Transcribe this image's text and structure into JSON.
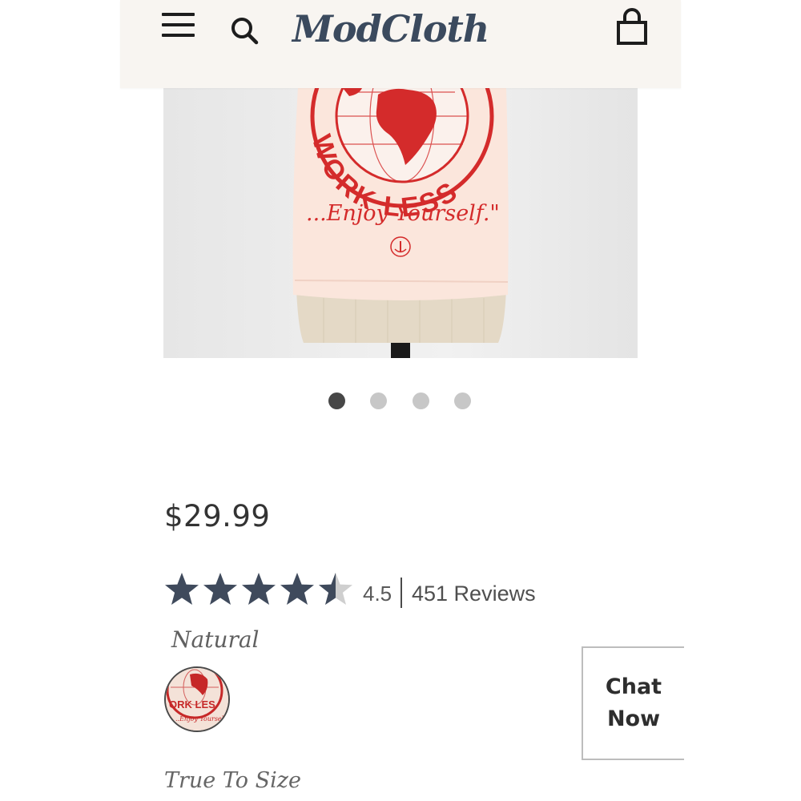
{
  "header": {
    "logo": "ModCloth",
    "icons": {
      "menu": "hamburger-menu-icon",
      "search": "search-icon",
      "cart": "shopping-bag-icon"
    }
  },
  "product_image": {
    "print_text": "WORK LESS",
    "print_script": "...Enjoy Yourself.\""
  },
  "carousel": {
    "count": 4,
    "active_index": 0
  },
  "product": {
    "price": "$29.99",
    "rating": {
      "stars": 4.5,
      "value": "4.5",
      "reviews": "451 Reviews"
    },
    "color_label": "Natural",
    "fit_label": "True To Size"
  },
  "chat": {
    "line1": "Chat",
    "line2": "Now"
  },
  "colors": {
    "header_bg": "#f8f5f1",
    "logo": "#3b4a5e",
    "star_filled": "#3f4a5c",
    "star_empty": "#cfcfcf",
    "dot_active": "#474747",
    "dot_inactive": "#c7c7c7",
    "print_red": "#d42b2b",
    "shirt": "#fbe6dc"
  }
}
